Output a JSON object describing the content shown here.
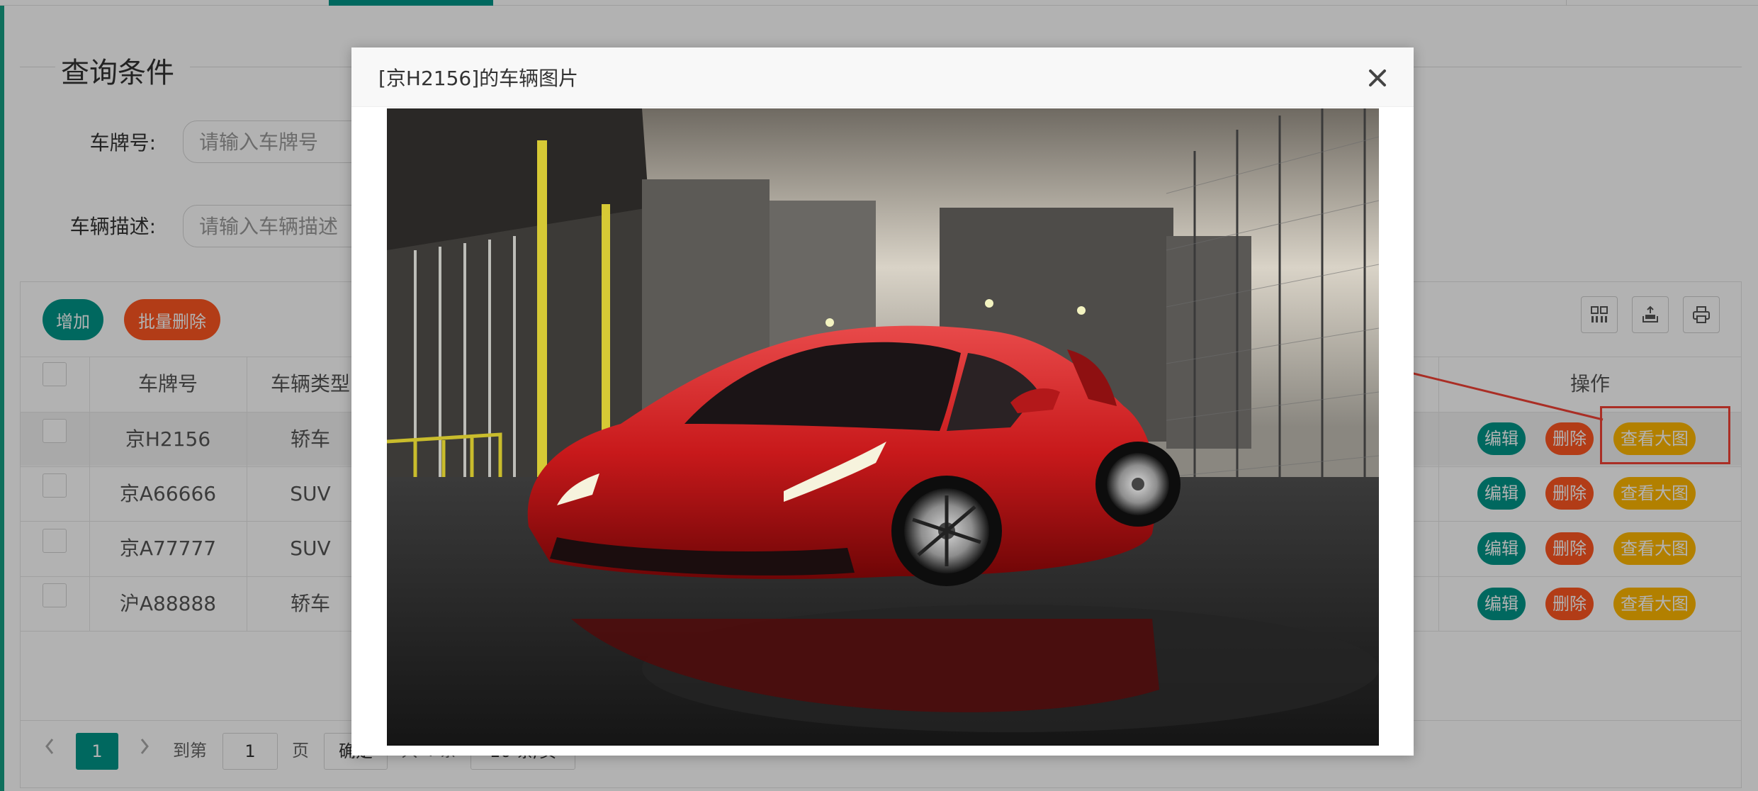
{
  "query_panel": {
    "legend": "查询条件",
    "plate_label": "车牌号:",
    "plate_placeholder": "请输入车牌号",
    "desc_label": "车辆描述:",
    "desc_placeholder": "请输入车辆描述"
  },
  "toolbar": {
    "add_label": "增加",
    "batch_delete_label": "批量删除",
    "icons": [
      "columns-icon",
      "export-icon",
      "print-icon"
    ]
  },
  "table": {
    "headers": {
      "plate": "车牌号",
      "type": "车辆类型",
      "actions": "操作"
    },
    "rows": [
      {
        "plate": "京H2156",
        "type": "轿车"
      },
      {
        "plate": "京A66666",
        "type": "SUV"
      },
      {
        "plate": "京A77777",
        "type": "SUV"
      },
      {
        "plate": "沪A88888",
        "type": "轿车"
      }
    ],
    "actions": {
      "edit": "编辑",
      "delete": "删除",
      "view": "查看大图"
    }
  },
  "pagination": {
    "current_page": "1",
    "goto_label": "到第",
    "goto_value": "1",
    "page_unit": "页",
    "confirm_label": "确定",
    "total_fragment": "共 4 条",
    "page_size_fragment": "10 条/页"
  },
  "modal": {
    "title": "[京H2156]的车辆图片",
    "image_subject": "red sports car parked on wet asphalt in an industrial lot"
  },
  "colors": {
    "primary": "#009688",
    "danger": "#ff5722",
    "warm": "#ffb800",
    "annotation": "#f44336"
  }
}
